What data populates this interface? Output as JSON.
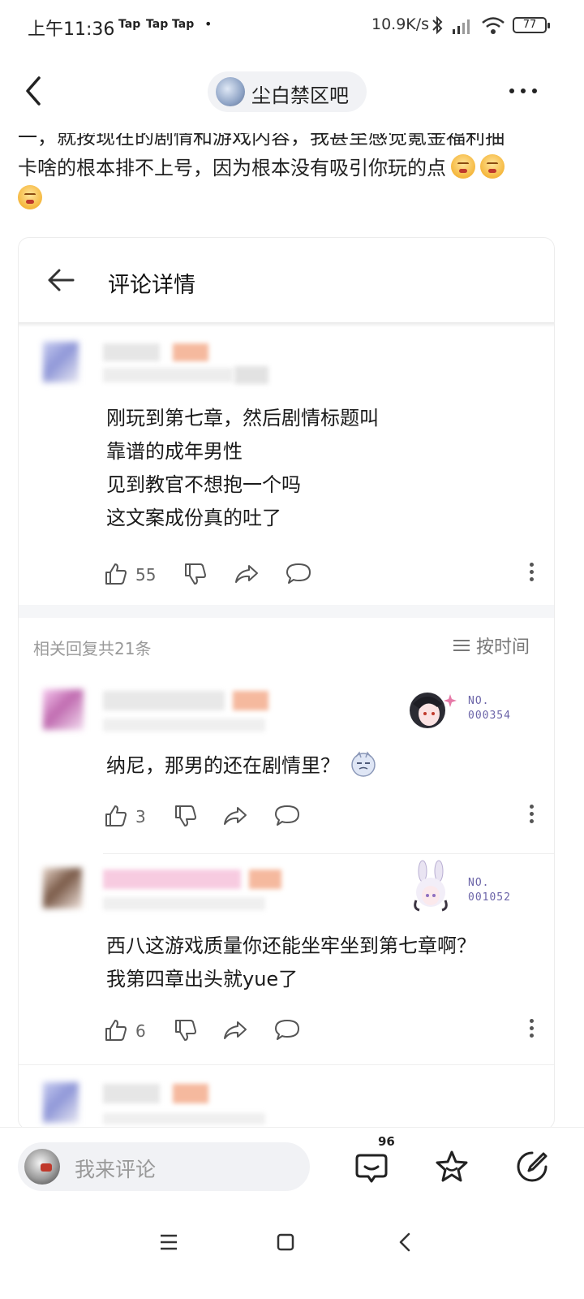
{
  "status_bar": {
    "time": "上午11:36",
    "notifications": [
      "Tap",
      "Tap",
      "Tap"
    ],
    "dot": "•",
    "net_speed": "10.9K/s",
    "battery": "77"
  },
  "navbar": {
    "forum_name": "尘白禁区吧"
  },
  "post": {
    "line1": "一，就按现在的剧情和游戏内容，我甚至感觉氪金福利抽",
    "line2": "卡啥的根本排不上号，因为根本没有吸引你玩的点"
  },
  "card": {
    "title": "评论详情",
    "main_comment": {
      "lines": [
        "刚玩到第七章，然后剧情标题叫",
        "靠谱的成年男性",
        "见到教官不想抱一个吗",
        "这文案成份真的吐了"
      ],
      "likes": "55"
    },
    "reply_count": "相关回复共21条",
    "sort_label": "按时间",
    "replies": [
      {
        "badge_no": "NO.",
        "badge_id": "000354",
        "text": "纳尼，那男的还在剧情里？",
        "likes": "3"
      },
      {
        "badge_no": "NO.",
        "badge_id": "001052",
        "lines": [
          "西八这游戏质量你还能坐牢坐到第七章啊？",
          "我第四章出头就yue了"
        ],
        "likes": "6"
      }
    ]
  },
  "bottom_bar": {
    "placeholder": "我来评论",
    "comment_count": "96"
  },
  "icons": [
    "back-icon",
    "more-icon",
    "emoji-grin-icon",
    "thumb-up-icon",
    "thumb-down-icon",
    "share-icon",
    "comment-icon",
    "kebab-icon",
    "sort-icon",
    "star-icon",
    "edit-icon",
    "menu-icon",
    "home-icon",
    "back-nav-icon"
  ]
}
